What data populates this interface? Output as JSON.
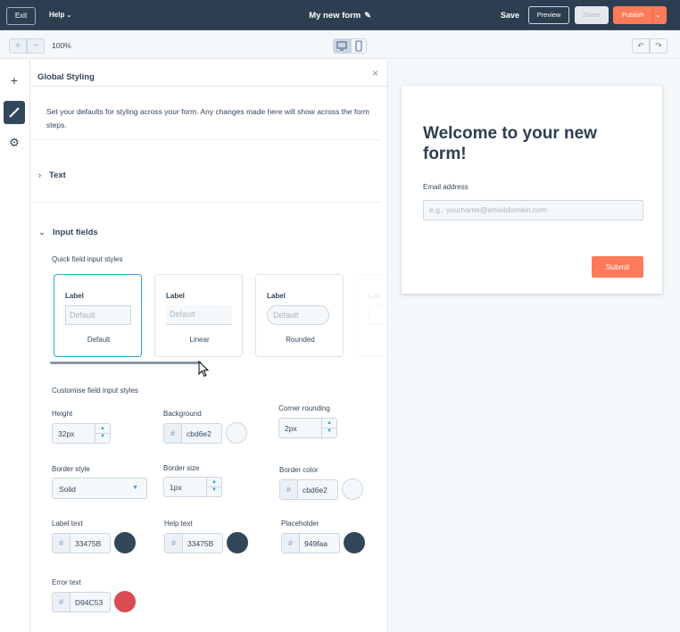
{
  "topbar": {
    "exit_label": "Exit",
    "help_label": "Help",
    "form_title": "My new form",
    "save_label": "Save",
    "preview_label": "Preview",
    "share_label": "Share",
    "publish_label": "Publish"
  },
  "toolbar": {
    "zoom_in": "+",
    "zoom_out": "−",
    "zoom_level": "100%",
    "undo": "↶",
    "redo": "↷"
  },
  "rail": {
    "add_icon": "+",
    "style_icon": "/",
    "settings_icon": "⚙"
  },
  "panel": {
    "title": "Global Styling",
    "close": "×",
    "description": "Set your defaults for styling across your form. Any changes made here will show across the form steps.",
    "sections": {
      "text": "Text",
      "input_fields": "Input fields"
    },
    "quick_styles_label": "Quick field input styles",
    "quick_styles": [
      {
        "label": "Label",
        "placeholder": "Default",
        "name": "Default",
        "selected": true
      },
      {
        "label": "Label",
        "placeholder": "Default",
        "name": "Linear",
        "selected": false
      },
      {
        "label": "Label",
        "placeholder": "Default",
        "name": "Rounded",
        "selected": false
      },
      {
        "label": "Lab",
        "placeholder": "",
        "name": "",
        "selected": false
      }
    ],
    "custom_label": "Customise field input styles",
    "fields": {
      "height": {
        "label": "Height",
        "value": "32px"
      },
      "background": {
        "label": "Background",
        "value": "cbd6e2",
        "color": "#cbd6e2"
      },
      "corner_rounding": {
        "label": "Corner rounding",
        "value": "2px"
      },
      "border_style": {
        "label": "Border style",
        "value": "Solid"
      },
      "border_size": {
        "label": "Border size",
        "value": "1px"
      },
      "border_color": {
        "label": "Border color",
        "value": "cbd6e2",
        "color": "#cbd6e2"
      },
      "label_text": {
        "label": "Label text",
        "value": "33475B",
        "color": "#33475b"
      },
      "help_text": {
        "label": "Help text",
        "value": "33475B",
        "color": "#33475b"
      },
      "placeholder": {
        "label": "Placeholder",
        "value": "949faa",
        "color": "#33475b"
      },
      "error_text": {
        "label": "Error text",
        "value": "D94C53",
        "color": "#d94c53"
      }
    },
    "hash": "#"
  },
  "preview": {
    "heading": "Welcome to your new form!",
    "email_label": "Email address",
    "email_placeholder": "e.g.: yourname@emaildomain.com",
    "submit_label": "Submit"
  },
  "colors": {
    "topbar": "#2d3e50",
    "accent": "#ff7a59",
    "selected": "#2aa7cf",
    "text": "#33475b",
    "error": "#d94c53"
  }
}
